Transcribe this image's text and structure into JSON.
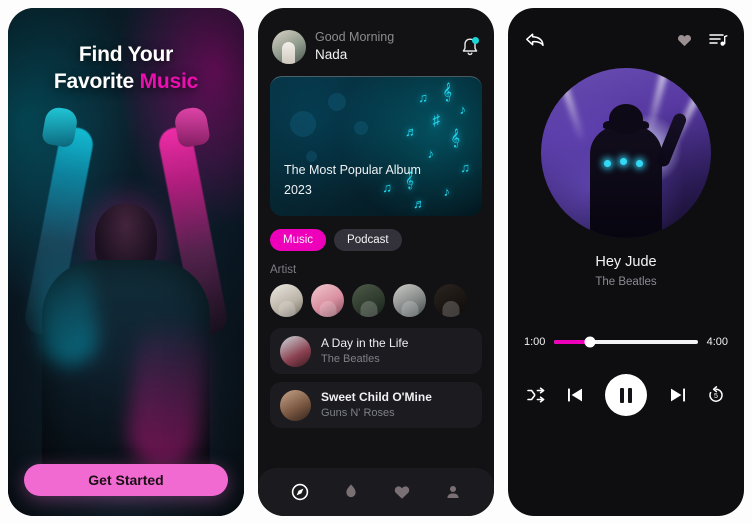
{
  "colors": {
    "accent_pink": "#ee00bb",
    "cta_pink": "#f06ad2",
    "cyan": "#18d7d7",
    "panel_bg": "#121215",
    "card_bg": "#1b1b20"
  },
  "screen_onboarding": {
    "name": "onboarding",
    "title_line1": "Find Your",
    "title_line2_plain": "Favorite ",
    "title_line2_accent": "Music",
    "cta_label": "Get Started"
  },
  "screen_home": {
    "name": "home",
    "header": {
      "greeting": "Good Morning",
      "user_name": "Nada",
      "avatar_icon": "user-avatar",
      "bell_icon": "bell-icon",
      "has_notification": true
    },
    "banner": {
      "line1": "The Most Popular Album",
      "line2": "2023"
    },
    "chips": [
      {
        "label": "Music",
        "active": true
      },
      {
        "label": "Podcast",
        "active": false
      }
    ],
    "artist_section_label": "Artist",
    "artists": [
      {
        "name": "artist-1"
      },
      {
        "name": "artist-2"
      },
      {
        "name": "artist-3"
      },
      {
        "name": "artist-4"
      },
      {
        "name": "artist-5"
      }
    ],
    "songs": [
      {
        "title": "A Day in the Life",
        "artist": "The Beatles",
        "bold": false
      },
      {
        "title": "Sweet Child O'Mine",
        "artist": "Guns N' Roses",
        "bold": true
      }
    ],
    "tabbar": [
      {
        "icon": "compass-icon",
        "active": true
      },
      {
        "icon": "flame-icon",
        "active": false
      },
      {
        "icon": "heart-icon",
        "active": false
      },
      {
        "icon": "person-icon",
        "active": false
      }
    ]
  },
  "screen_player": {
    "name": "player",
    "topbar": {
      "back_icon": "back-arrow-icon",
      "favorite_icon": "heart-icon",
      "queue_icon": "playlist-queue-icon"
    },
    "cover_alt": "dj-concert-album-art",
    "track_title": "Hey Jude",
    "track_artist": "The Beatles",
    "progress": {
      "elapsed": "1:00",
      "total": "4:00",
      "percent": 25
    },
    "controls": [
      {
        "icon": "shuffle-icon",
        "label": "shuffle"
      },
      {
        "icon": "previous-icon",
        "label": "previous"
      },
      {
        "icon": "pause-icon",
        "label": "pause"
      },
      {
        "icon": "next-icon",
        "label": "next"
      },
      {
        "icon": "replay-5-icon",
        "label": "replay"
      }
    ]
  }
}
